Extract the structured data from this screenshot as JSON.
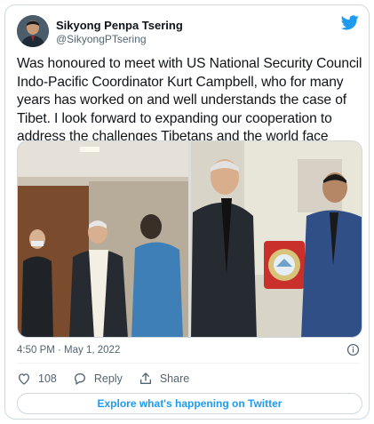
{
  "tweet": {
    "author_name": "Sikyong Penpa Tsering",
    "author_handle": "@SikyongPTsering",
    "text": "Was honoured to meet with US National Security Council Indo-Pacific Coordinator Kurt Campbell, who for many years has worked on and well understands the case of Tibet. I look forward to expanding our cooperation to address the challenges Tibetans and the world face today.",
    "timestamp": "4:50 PM · May 1, 2022",
    "like_count": "108",
    "reply_label": "Reply",
    "share_label": "Share",
    "explore_label": "Explore what's happening on Twitter"
  },
  "icons": {
    "logo": "twitter-bird-icon",
    "info": "info-icon",
    "like": "heart-icon",
    "reply": "reply-bubble-icon",
    "share": "share-icon"
  },
  "colors": {
    "brand": "#1d9bf0",
    "text": "#0f1419",
    "secondary": "#536471",
    "border": "#cfd9de"
  }
}
